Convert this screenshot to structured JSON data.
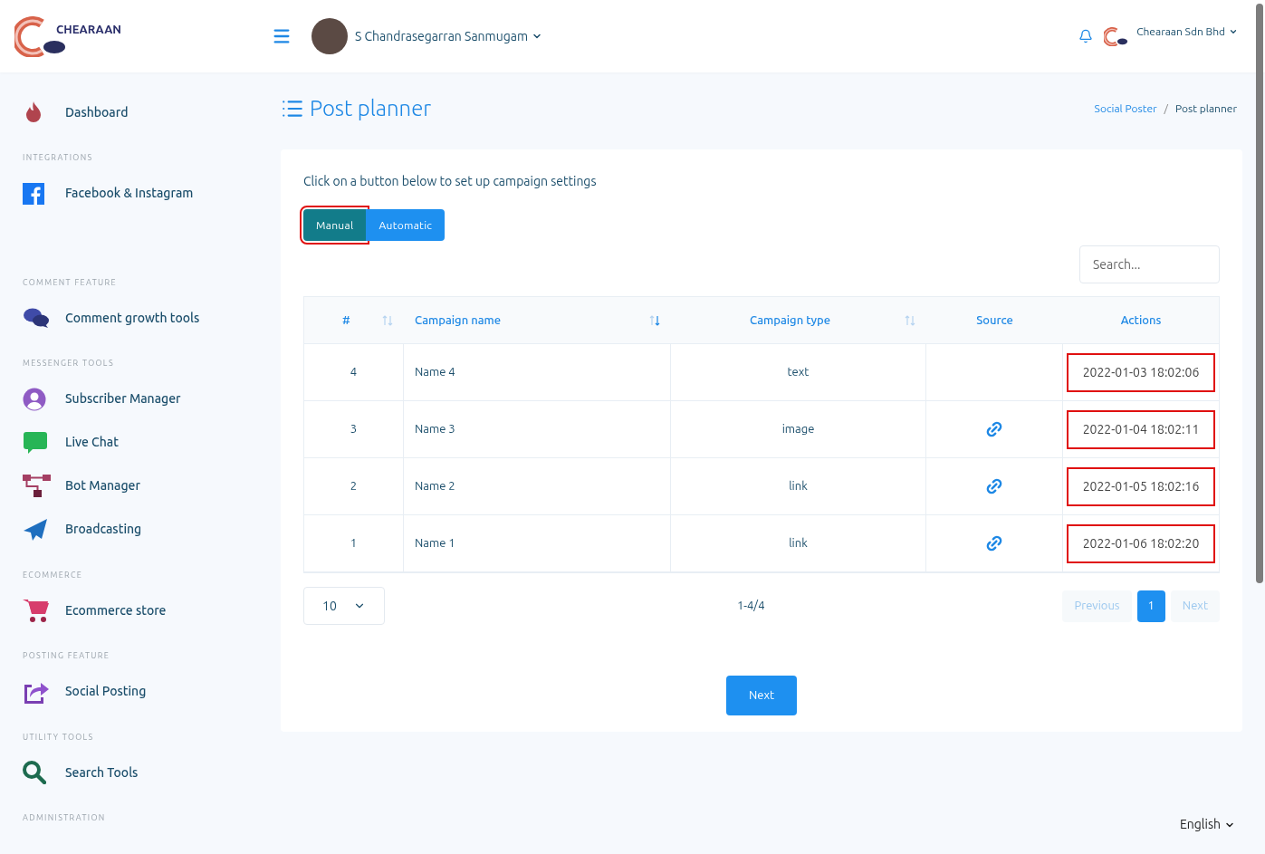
{
  "header": {
    "logo_text": "CHEARAAN",
    "user_name": "S Chandrasegarran Sanmugam",
    "company": "Chearaan Sdn Bhd"
  },
  "sidebar": [
    {
      "items": [
        {
          "label": "Dashboard"
        }
      ]
    },
    {
      "heading": "INTEGRATIONS",
      "items": [
        {
          "label": "Facebook & Instagram"
        }
      ]
    },
    {
      "heading": "COMMENT FEATURE",
      "items": [
        {
          "label": "Comment growth tools"
        }
      ]
    },
    {
      "heading": "MESSENGER TOOLS",
      "items": [
        {
          "label": "Subscriber Manager"
        },
        {
          "label": "Live Chat"
        },
        {
          "label": "Bot Manager"
        },
        {
          "label": "Broadcasting"
        }
      ]
    },
    {
      "heading": "ECOMMERCE",
      "items": [
        {
          "label": "Ecommerce store"
        }
      ]
    },
    {
      "heading": "POSTING FEATURE",
      "items": [
        {
          "label": "Social Posting"
        }
      ]
    },
    {
      "heading": "UTILITY TOOLS",
      "items": [
        {
          "label": "Search Tools"
        }
      ]
    },
    {
      "heading": "ADMINISTRATION"
    }
  ],
  "page_title": "Post planner",
  "breadcrumb": {
    "separator": "/",
    "items": [
      {
        "label": "Social Poster",
        "current": false
      },
      {
        "label": "Post planner",
        "current": true
      }
    ]
  },
  "intro": "Click on a button below to set up campaign settings",
  "mode_buttons": [
    {
      "label": "Manual",
      "selected": true,
      "marked": true
    },
    {
      "label": "Automatic",
      "selected": false,
      "marked": false
    }
  ],
  "search": {
    "placeholder": "Search..."
  },
  "table": {
    "columns": [
      {
        "label": "#",
        "sorted": false
      },
      {
        "label": "Campaign name",
        "sorted": true
      },
      {
        "label": "Campaign type",
        "sorted": false
      },
      {
        "label": "Source"
      },
      {
        "label": "Actions"
      }
    ],
    "rows": [
      {
        "id": "4",
        "name": "Name 4",
        "type": "text",
        "has_link": false,
        "action": "2022-01-03 18:02:06",
        "marked": true
      },
      {
        "id": "3",
        "name": "Name 3",
        "type": "image",
        "has_link": true,
        "action": "2022-01-04 18:02:11",
        "marked": true
      },
      {
        "id": "2",
        "name": "Name 2",
        "type": "link",
        "has_link": true,
        "action": "2022-01-05 18:02:16",
        "marked": true
      },
      {
        "id": "1",
        "name": "Name 1",
        "type": "link",
        "has_link": true,
        "action": "2022-01-06 18:02:20",
        "marked": true
      }
    ]
  },
  "page_size": "10",
  "range": "1-4/4",
  "pagination": [
    {
      "label": "Previous",
      "kind": "nav",
      "selected": false
    },
    {
      "label": "1",
      "kind": "page",
      "selected": true
    },
    {
      "label": "Next",
      "kind": "nav",
      "selected": false
    }
  ],
  "next_button": "Next",
  "language": "English"
}
